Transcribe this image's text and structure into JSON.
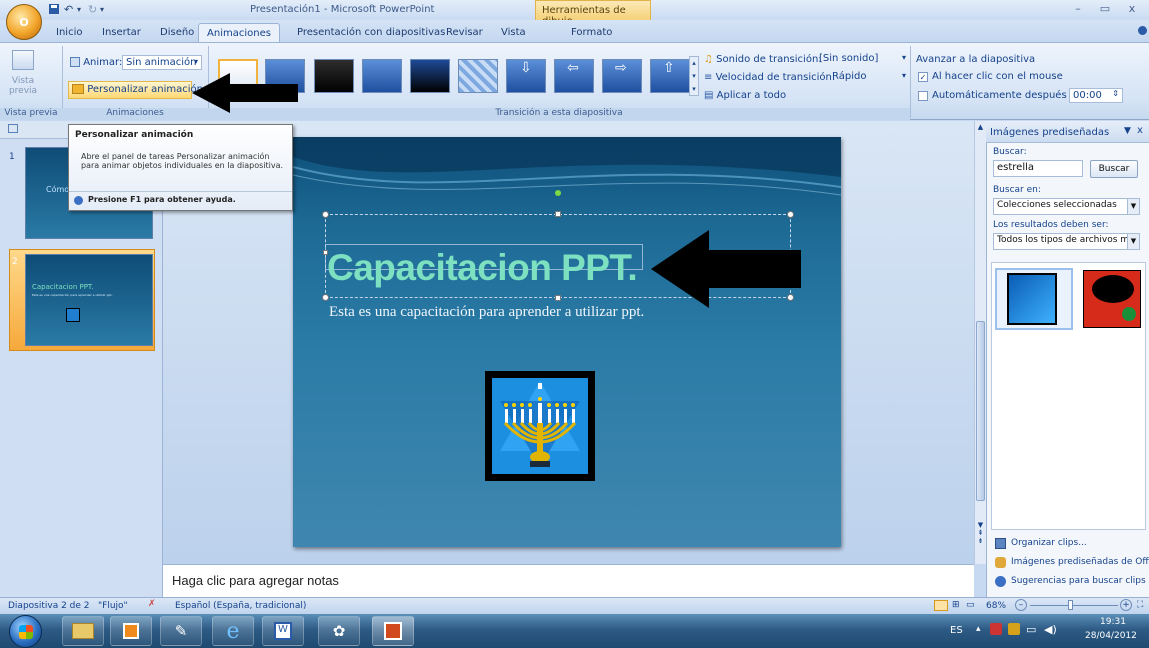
{
  "window": {
    "app_title": "Presentación1 - Microsoft PowerPoint",
    "context_group": "Herramientas de dibujo",
    "office_button": "O"
  },
  "tabs": [
    "Inicio",
    "Insertar",
    "Diseño",
    "Animaciones",
    "Presentación con diapositivas",
    "Revisar",
    "Vista",
    "Formato"
  ],
  "ribbon": {
    "vista_previa": {
      "label_line1": "Vista",
      "label_line2": "previa",
      "group": "Vista previa"
    },
    "animaciones": {
      "animar_label": "Animar:",
      "animar_value": "Sin animación",
      "personalizar": "Personalizar animación",
      "group": "Animaciones"
    },
    "transicion": {
      "sonido_label": "Sonido de transición:",
      "sonido_value": "[Sin sonido]",
      "velocidad_label": "Velocidad de transición:",
      "velocidad_value": "Rápido",
      "aplicar": "Aplicar a todo",
      "group": "Transición a esta diapositiva"
    },
    "avanzar": {
      "title": "Avanzar a la diapositiva",
      "al_hacer_clic": "Al hacer clic con el mouse",
      "al_hacer_clic_checked": true,
      "automaticamente": "Automáticamente después de:",
      "automaticamente_checked": false,
      "time": "00:00"
    }
  },
  "tooltip": {
    "title": "Personalizar animación",
    "body": "Abre el panel de tareas Personalizar animación para animar objetos individuales en la diapositiva.",
    "help": "Presione F1 para obtener ayuda."
  },
  "thumbnails": [
    {
      "number": "1",
      "text": "Cómo"
    },
    {
      "number": "2",
      "title": "Capacitacion PPT.",
      "subtitle": "Esta es una capacitación para aprender a utilizar ppt."
    }
  ],
  "slide": {
    "title": "Capacitacion PPT.",
    "subtitle": "Esta es una capacitación para aprender a utilizar ppt."
  },
  "notes": {
    "placeholder": "Haga clic para agregar notas"
  },
  "clipart_pane": {
    "title": "Imágenes prediseñadas",
    "buscar_label": "Buscar:",
    "search_value": "estrella",
    "buscar_button": "Buscar",
    "buscar_en_label": "Buscar en:",
    "buscar_en_value": "Colecciones seleccionadas",
    "resultados_label": "Los resultados deben ser:",
    "resultados_value": "Todos los tipos de archivos mult",
    "links": [
      "Organizar clips...",
      "Imágenes prediseñadas de Office",
      "Sugerencias para buscar clips"
    ]
  },
  "statusbar": {
    "slide_info": "Diapositiva 2 de 2",
    "theme": "\"Flujo\"",
    "language": "Español (España, tradicional)",
    "zoom": "68%"
  },
  "taskbar": {
    "lang": "ES",
    "time": "19:31",
    "date": "28/04/2012"
  },
  "colors": {
    "accent_green": "#7de0c0",
    "ribbon_blue": "#15428b",
    "slide_blue": "#1d6a95"
  }
}
